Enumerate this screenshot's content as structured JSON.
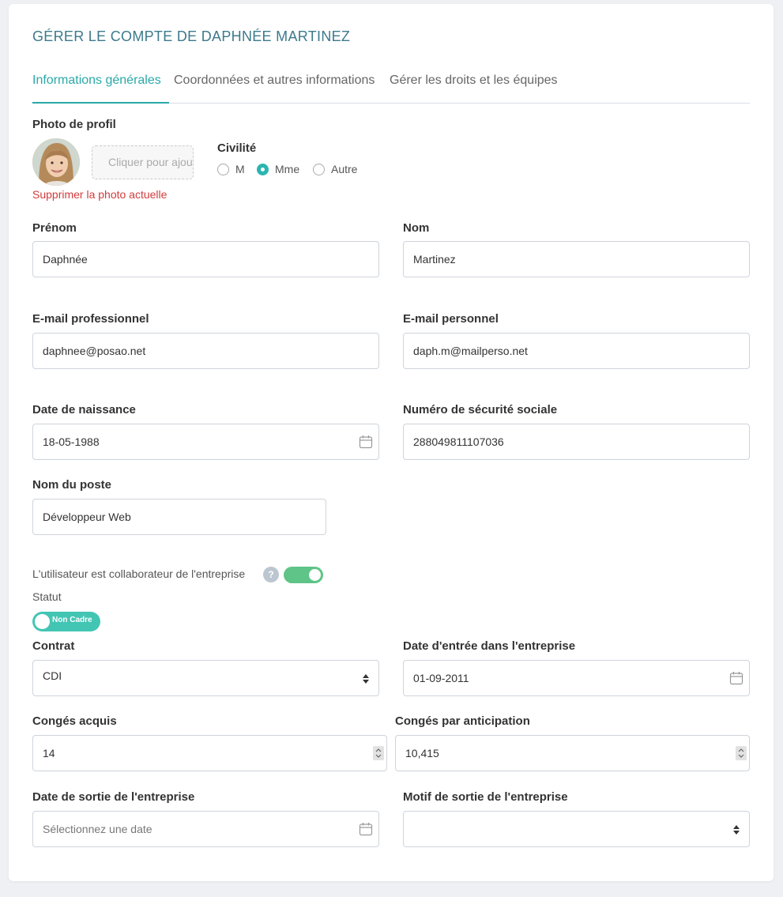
{
  "page_title": "GÉRER LE COMPTE DE DAPHNÉE MARTINEZ",
  "tabs": [
    {
      "label": "Informations générales",
      "active": true
    },
    {
      "label": "Coordonnées et autres informations",
      "active": false
    },
    {
      "label": "Gérer les droits et les équipes",
      "active": false
    }
  ],
  "profile_photo": {
    "label": "Photo de profil",
    "upload_label": "Cliquer pour ajouter",
    "delete_label": "Supprimer la photo actuelle"
  },
  "civility": {
    "label": "Civilité",
    "options": [
      {
        "label": "M",
        "checked": false
      },
      {
        "label": "Mme",
        "checked": true
      },
      {
        "label": "Autre",
        "checked": false
      }
    ]
  },
  "fields": {
    "first_name": {
      "label": "Prénom",
      "value": "Daphnée"
    },
    "last_name": {
      "label": "Nom",
      "value": "Martinez"
    },
    "work_email": {
      "label": "E-mail professionnel",
      "value": "daphnee@posao.net"
    },
    "personal_email": {
      "label": "E-mail personnel",
      "value": "daph.m@mailperso.net"
    },
    "birth_date": {
      "label": "Date de naissance",
      "value": "18-05-1988"
    },
    "ssn": {
      "label": "Numéro de sécurité sociale",
      "value": "288049811107036"
    },
    "job_title": {
      "label": "Nom du poste",
      "value": "Développeur Web"
    },
    "contract": {
      "label": "Contrat",
      "value": "CDI"
    },
    "entry_date": {
      "label": "Date d'entrée dans l'entreprise",
      "value": "01-09-2011"
    },
    "acquired_leave": {
      "label": "Congés acquis",
      "value": "14"
    },
    "anticipated_leave": {
      "label": "Congés par anticipation",
      "value": "10,415"
    },
    "exit_date": {
      "label": "Date de sortie de l'entreprise",
      "placeholder": "Sélectionnez une date"
    },
    "exit_reason": {
      "label": "Motif de sortie de l'entreprise",
      "value": ""
    }
  },
  "collaborator": {
    "label": "L'utilisateur est collaborateur de l'entreprise",
    "help": "?",
    "enabled": true
  },
  "status": {
    "label": "Statut",
    "toggle_text": "Non Cadre"
  },
  "colors": {
    "accent": "#2aa8a8",
    "title": "#3d7a8c",
    "danger": "#d23b3b",
    "toggle_on": "#5ec487",
    "status_pill": "#43c5b4"
  }
}
